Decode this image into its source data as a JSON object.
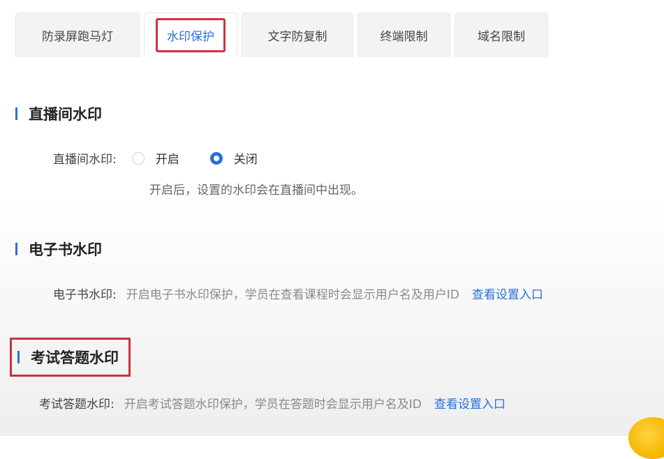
{
  "tabs": [
    {
      "label": "防录屏跑马灯"
    },
    {
      "label": "水印保护"
    },
    {
      "label": "文字防复制"
    },
    {
      "label": "终端限制"
    },
    {
      "label": "域名限制"
    }
  ],
  "active_tab": "水印保护",
  "sections": {
    "live": {
      "title": "直播间水印",
      "field_label": "直播间水印:",
      "options": [
        {
          "label": "开启",
          "checked": false
        },
        {
          "label": "关闭",
          "checked": true
        }
      ],
      "hint": "开启后，设置的水印会在直播间中出现。"
    },
    "ebook": {
      "title": "电子书水印",
      "field_label": "电子书水印:",
      "description": "开启电子书水印保护，学员在查看课程时会显示用户名及用户ID",
      "link": "查看设置入口"
    },
    "exam": {
      "title": "考试答题水印",
      "field_label": "考试答题水印:",
      "description": "开启考试答题水印保护，学员在答题时会显示用户名及ID",
      "link": "查看设置入口"
    }
  },
  "colors": {
    "accent": "#2b6fd6",
    "highlight_box": "#d0313a"
  }
}
